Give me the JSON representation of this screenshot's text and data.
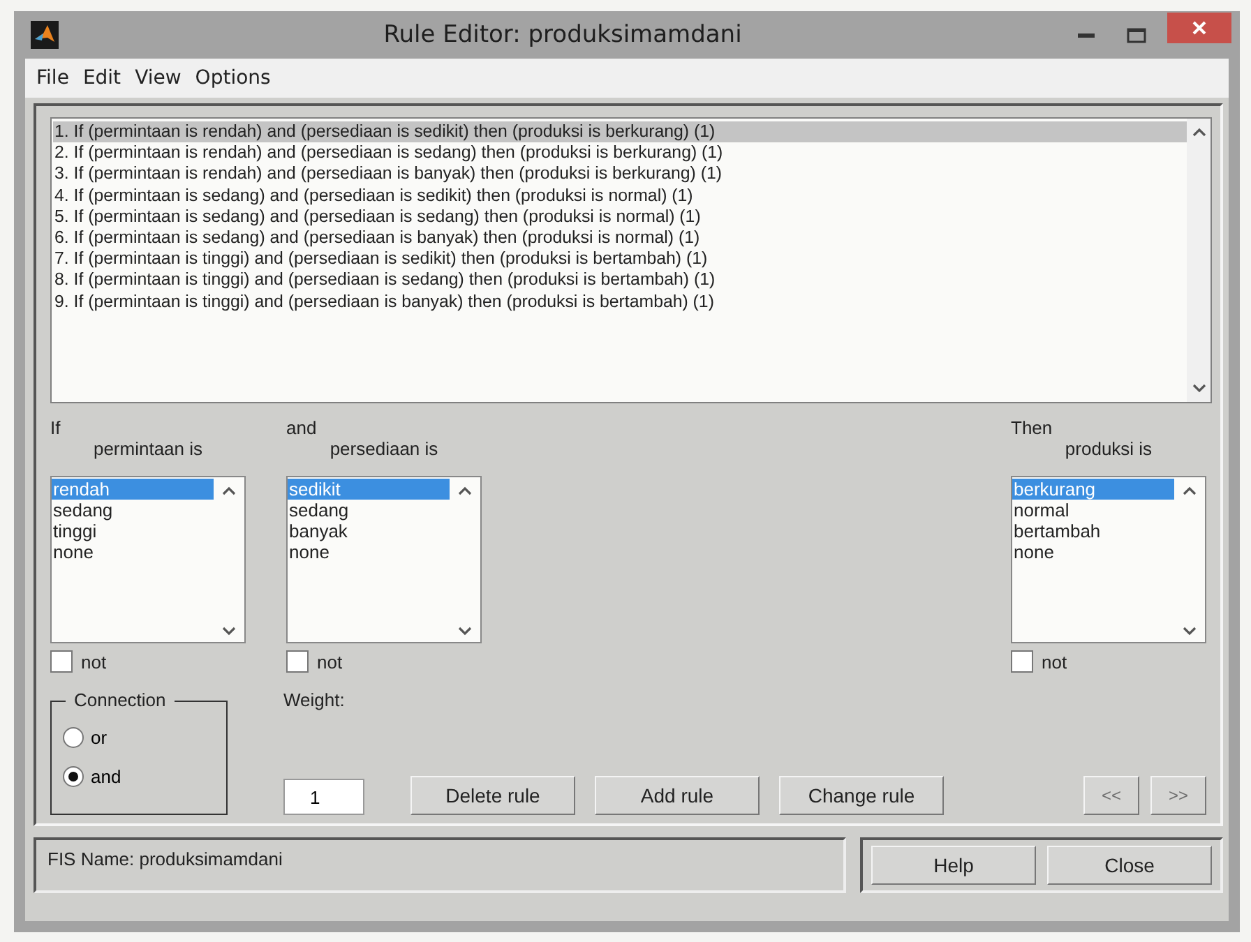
{
  "window": {
    "title": "Rule Editor: produksimamdani"
  },
  "menu": [
    "File",
    "Edit",
    "View",
    "Options"
  ],
  "rules": [
    {
      "text": "1. If (permintaan is rendah) and (persediaan is sedikit) then (produksi is berkurang) (1)",
      "selected": true
    },
    {
      "text": "2. If (permintaan is rendah) and (persediaan is sedang) then (produksi is berkurang) (1)",
      "selected": false
    },
    {
      "text": "3. If (permintaan is rendah) and (persediaan is banyak) then (produksi is berkurang) (1)",
      "selected": false
    },
    {
      "text": "4. If (permintaan is sedang) and (persediaan is sedikit) then (produksi is normal) (1)",
      "selected": false
    },
    {
      "text": "5. If (permintaan is sedang) and (persediaan is sedang) then (produksi is normal) (1)",
      "selected": false
    },
    {
      "text": "6. If (permintaan is sedang) and (persediaan is banyak) then (produksi is normal) (1)",
      "selected": false
    },
    {
      "text": "7. If (permintaan is tinggi) and (persediaan is sedikit) then (produksi is bertambah) (1)",
      "selected": false
    },
    {
      "text": "8. If (permintaan is tinggi) and (persediaan is sedang) then (produksi is bertambah) (1)",
      "selected": false
    },
    {
      "text": "9. If (permintaan is tinggi) and (persediaan is banyak) then (produksi is bertambah) (1)",
      "selected": false
    }
  ],
  "variables": [
    {
      "kind": "input",
      "heading": "If",
      "label": "permintaan is",
      "items": [
        {
          "label": "rendah",
          "selected": true
        },
        {
          "label": "sedang",
          "selected": false
        },
        {
          "label": "tinggi",
          "selected": false
        },
        {
          "label": "none",
          "selected": false
        }
      ],
      "not": {
        "label": "not",
        "checked": false
      }
    },
    {
      "kind": "input",
      "heading": "and",
      "label": "persediaan is",
      "items": [
        {
          "label": "sedikit",
          "selected": true
        },
        {
          "label": "sedang",
          "selected": false
        },
        {
          "label": "banyak",
          "selected": false
        },
        {
          "label": "none",
          "selected": false
        }
      ],
      "not": {
        "label": "not",
        "checked": false
      }
    },
    {
      "kind": "output",
      "heading": "Then",
      "label": "produksi is",
      "items": [
        {
          "label": "berkurang",
          "selected": true
        },
        {
          "label": "normal",
          "selected": false
        },
        {
          "label": "bertambah",
          "selected": false
        },
        {
          "label": "none",
          "selected": false
        }
      ],
      "not": {
        "label": "not",
        "checked": false
      }
    }
  ],
  "connection": {
    "title": "Connection",
    "options": [
      {
        "label": "or",
        "selected": false
      },
      {
        "label": "and",
        "selected": true
      }
    ]
  },
  "weight": {
    "label": "Weight:",
    "value": "1"
  },
  "buttons": [
    {
      "label": "Delete rule",
      "disabled": false
    },
    {
      "label": "Add rule",
      "disabled": false
    },
    {
      "label": "Change rule",
      "disabled": false
    }
  ],
  "nav_buttons": [
    {
      "label": "<<",
      "disabled": true
    },
    {
      "label": ">>",
      "disabled": true
    }
  ],
  "status": {
    "text": "FIS Name: produksimamdani"
  },
  "footer_buttons": [
    {
      "label": "Help"
    },
    {
      "label": "Close"
    }
  ]
}
